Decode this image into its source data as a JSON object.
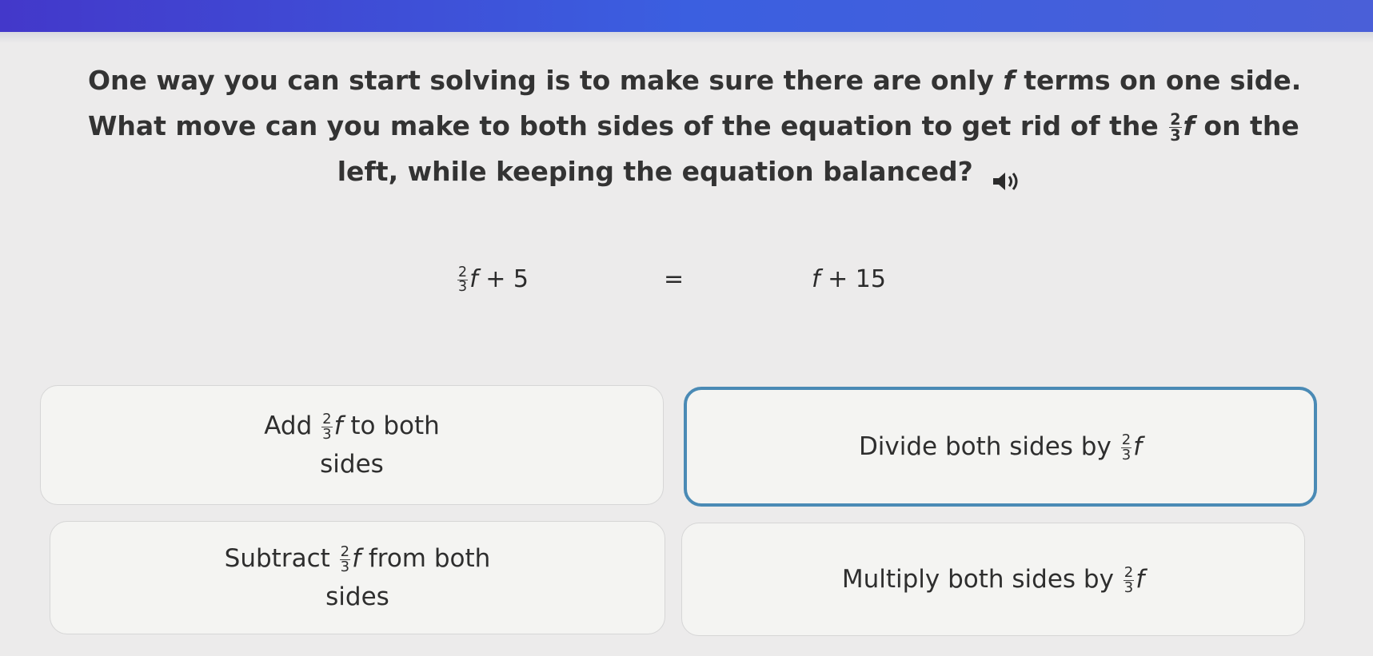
{
  "prompt": {
    "line1_before": "One way you can start solving is to make sure there are only",
    "line1_var": "f",
    "line1_after": "terms on one side.",
    "line2_before": "What move can you make to both sides of the equation to get rid of the",
    "line2_var": "f",
    "line2_after": "on the",
    "line3": "left, while keeping the equation balanced?",
    "speaker_icon": "speaker-icon"
  },
  "fraction": {
    "numerator": "2",
    "denominator": "3"
  },
  "equation": {
    "left_var": "f",
    "left_rest": "+ 5",
    "equals": "=",
    "right_var": "f",
    "right_rest": "+ 15"
  },
  "choices": {
    "a": {
      "before": "Add",
      "var": "f",
      "after": "to both",
      "line2": "sides"
    },
    "b": {
      "before": "Divide both sides by",
      "var": "f",
      "selected": true
    },
    "c": {
      "before": "Subtract",
      "var": "f",
      "after": "from both",
      "line2": "sides"
    },
    "d": {
      "before": "Multiply both sides by",
      "var": "f"
    }
  },
  "colors": {
    "topbar": "#4338ca",
    "selected_border": "#4a8ab5",
    "background": "#ecebeb"
  }
}
